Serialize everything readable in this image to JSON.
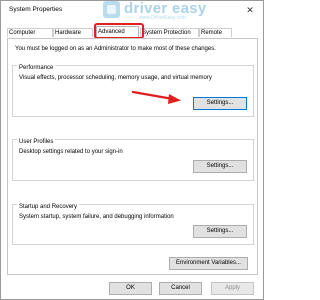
{
  "window": {
    "title": "System Properties",
    "close_glyph": "✕"
  },
  "watermark": {
    "logo_icon": "driver-easy-logo-icon",
    "name": "driver easy",
    "url": "www.DriverEasy.com"
  },
  "tabs": [
    {
      "label": "Computer Name",
      "active": false
    },
    {
      "label": "Hardware",
      "active": false
    },
    {
      "label": "Advanced",
      "active": true
    },
    {
      "label": "System Protection",
      "active": false
    },
    {
      "label": "Remote",
      "active": false
    }
  ],
  "admin_note": "You must be logged on as an Administrator to make most of these changes.",
  "performance": {
    "title": "Performance",
    "description": "Visual effects, processor scheduling, memory usage, and virtual memory",
    "button": "Settings..."
  },
  "user_profiles": {
    "title": "User Profiles",
    "description": "Desktop settings related to your sign-in",
    "button": "Settings..."
  },
  "startup_recovery": {
    "title": "Startup and Recovery",
    "description": "System startup, system failure, and debugging information",
    "button": "Settings..."
  },
  "env_button": "Environment Variables...",
  "footer": {
    "ok": "OK",
    "cancel": "Cancel",
    "apply": "Apply"
  },
  "colors": {
    "highlight": "#e02020",
    "focus": "#0078d7",
    "watermark": "#a9d3ea"
  }
}
